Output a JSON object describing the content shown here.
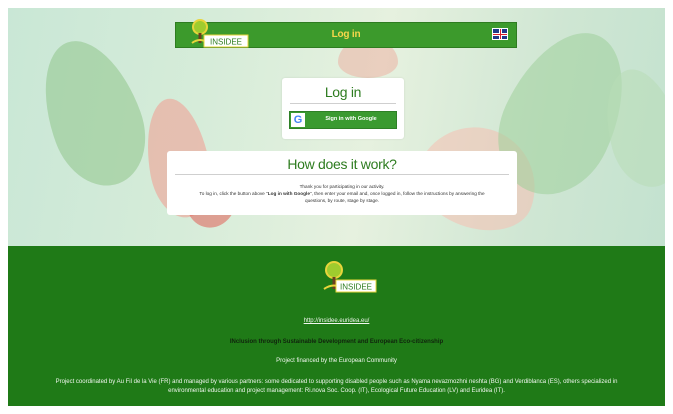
{
  "brand": {
    "logo_text": "INSIDEE"
  },
  "header": {
    "title": "Log in",
    "language_flag": "uk-flag-icon"
  },
  "login": {
    "heading": "Log in",
    "google_button": "Sign in with Google",
    "google_glyph": "G"
  },
  "how": {
    "heading": "How does it work?",
    "line1": "Thank you for participating in our activity.",
    "line2a": "To log in, click the button above \"",
    "line2b": "Log in with Google",
    "line2c": "\", then enter your email and, once logged in, follow the instructions by answering the",
    "line3": "questions, by route, stage by stage."
  },
  "footer": {
    "link": "http://insidee.euridea.eu/",
    "tagline": "INclusion through Sustainable Development and European Eco-citizenship",
    "financed": "Project financed by the European Community",
    "coordinated1": "Project coordinated by Au Fil de la Vie (FR) and managed by various partners: some dedicated to supporting disabled people such as Nyama nevazmozhni neshta (BG) and Verdiblanca (ES), others specialized in",
    "coordinated2": "environmental education and project management: Ri.nova Soc. Coop. (IT), Ecological Future Education (LV) and Euridea (IT)."
  },
  "colors": {
    "green": "#3c9a2c",
    "footer_green": "#1f7a17",
    "title_yellow": "#f7d74b"
  }
}
